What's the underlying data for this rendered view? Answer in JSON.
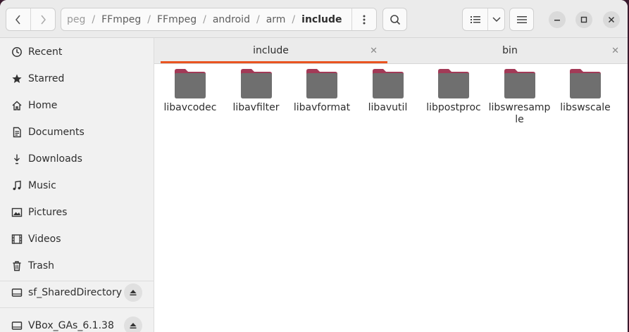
{
  "headerbar": {
    "breadcrumbs": [
      "peg",
      "FFmpeg",
      "FFmpeg",
      "android",
      "arm",
      "include"
    ],
    "separator": "/"
  },
  "sidebar": {
    "items": [
      {
        "label": "Recent",
        "icon": "clock-icon"
      },
      {
        "label": "Starred",
        "icon": "star-icon"
      },
      {
        "label": "Home",
        "icon": "home-icon"
      },
      {
        "label": "Documents",
        "icon": "document-icon"
      },
      {
        "label": "Downloads",
        "icon": "download-icon"
      },
      {
        "label": "Music",
        "icon": "music-icon"
      },
      {
        "label": "Pictures",
        "icon": "picture-icon"
      },
      {
        "label": "Videos",
        "icon": "video-icon"
      },
      {
        "label": "Trash",
        "icon": "trash-icon"
      }
    ],
    "devices": [
      {
        "label": "sf_SharedDirectory",
        "icon": "drive-icon"
      },
      {
        "label": "VBox_GAs_6.1.38",
        "icon": "disc-icon"
      }
    ]
  },
  "tabs": [
    {
      "label": "include",
      "active": true
    },
    {
      "label": "bin",
      "active": false
    }
  ],
  "files": [
    {
      "name": "libavcodec"
    },
    {
      "name": "libavfilter"
    },
    {
      "name": "libavformat"
    },
    {
      "name": "libavutil"
    },
    {
      "name": "libpostproc"
    },
    {
      "name": "libswresample"
    },
    {
      "name": "libswscale"
    }
  ],
  "colors": {
    "accent": "#e95420",
    "folder_body": "#6f6f6f",
    "folder_tab": "#a23a57"
  }
}
